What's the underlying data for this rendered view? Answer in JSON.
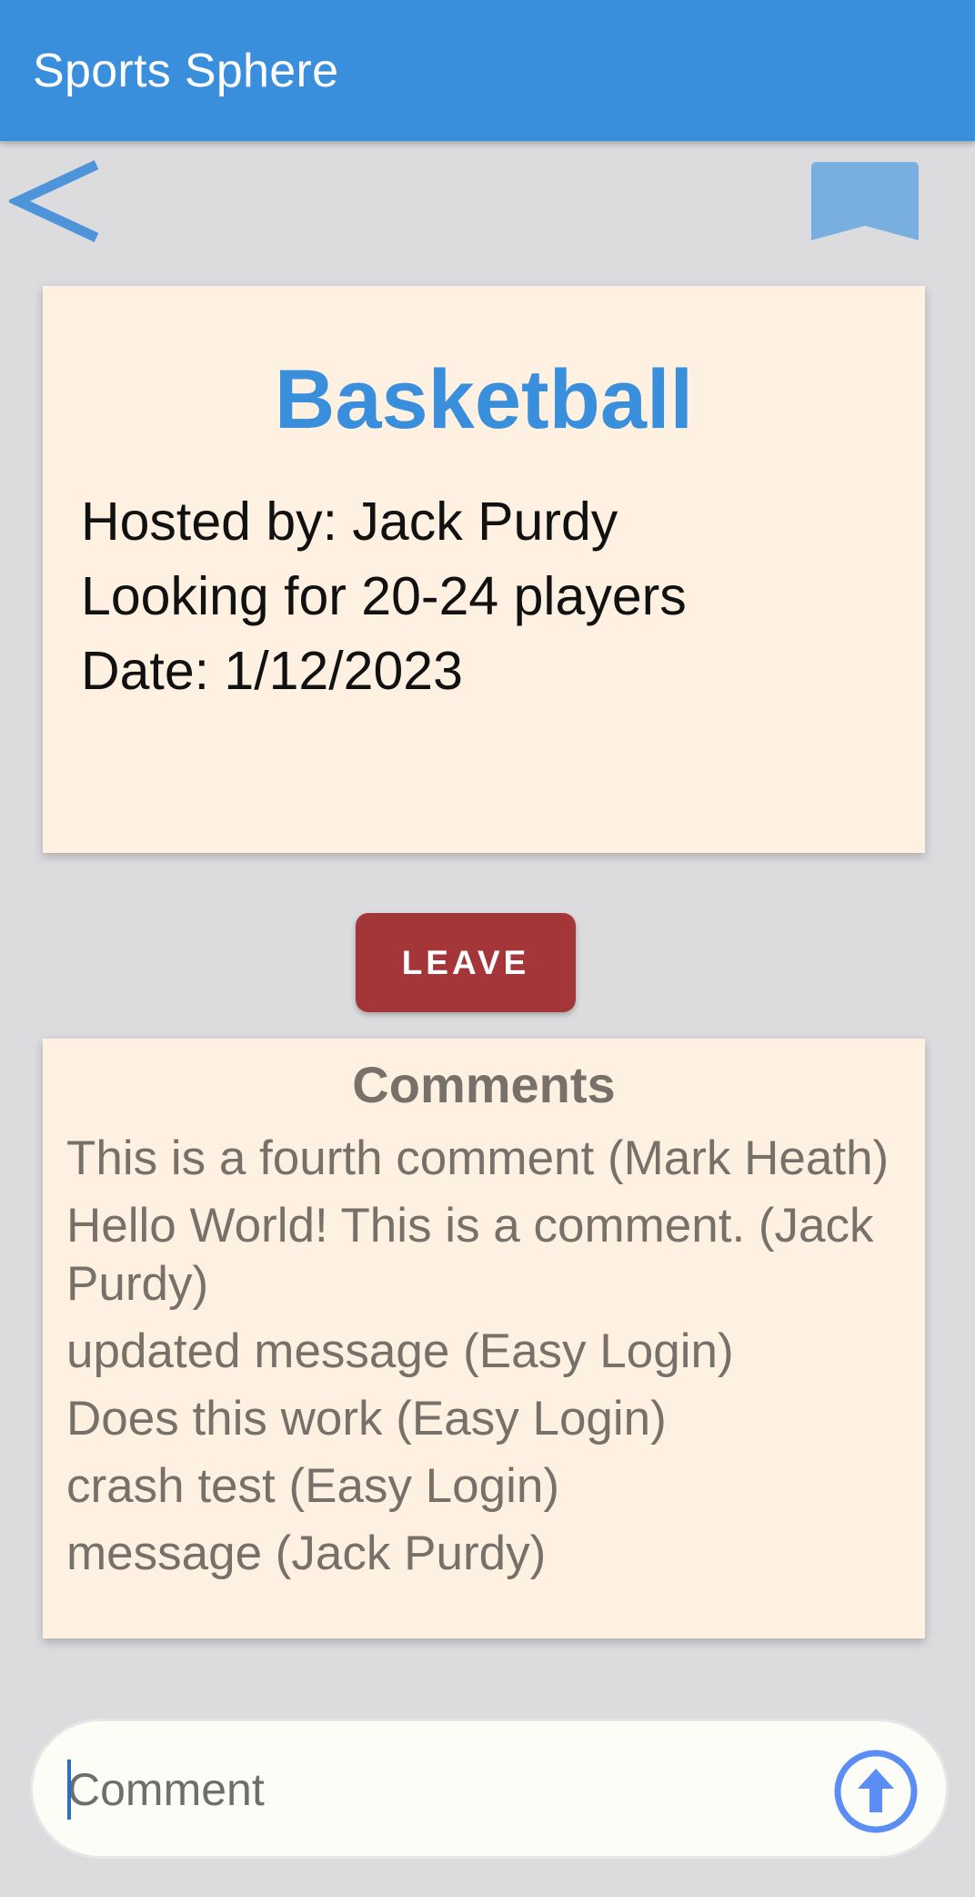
{
  "app": {
    "title": "Sports Sphere",
    "accent_color": "#3a8fdc"
  },
  "nav": {
    "back_icon": "chevron-left-icon",
    "bookmark_icon": "bookmark-icon"
  },
  "event": {
    "sport": "Basketball",
    "host_line": "Hosted by: Jack Purdy",
    "players_line": "Looking for 20-24 players",
    "date_line": "Date: 1/12/2023"
  },
  "actions": {
    "leave_label": "LEAVE",
    "leave_color": "#a43539"
  },
  "comments": {
    "heading": "Comments",
    "items": [
      "This is a fourth comment (Mark Heath)",
      "Hello World! This is a comment. (Jack Purdy)",
      "updated message (Easy Login)",
      "Does this work (Easy Login)",
      "crash test (Easy Login)",
      "message (Jack Purdy)"
    ]
  },
  "composer": {
    "placeholder": "Comment",
    "send_icon": "arrow-up-circle-icon"
  }
}
